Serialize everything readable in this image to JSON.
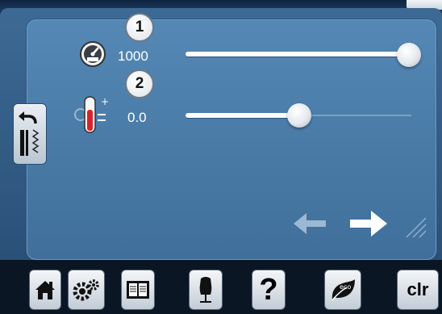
{
  "speed": {
    "badge": "1",
    "value": "1000",
    "level_fraction": 1.0
  },
  "tension": {
    "badge": "2",
    "value": "0.0",
    "level_fraction": 0.5
  },
  "icons": {
    "speed": "speedometer-icon",
    "tension": "thread-tension-icon",
    "side": "back-stitch-pattern-icon",
    "back": "arrow-left-icon",
    "forward": "arrow-right-icon"
  },
  "toolbar": {
    "home": "home-icon",
    "setup": "gears-icon",
    "tutorial": "book-icon",
    "consultant": "dress-form-icon",
    "help_label": "?",
    "eco": "eco-leaf-icon",
    "eco_label": "eco",
    "clr_label": "clr"
  },
  "colors": {
    "panel": "#4d80ad",
    "track": "#ffffff",
    "toolbar": "#0b1624"
  }
}
